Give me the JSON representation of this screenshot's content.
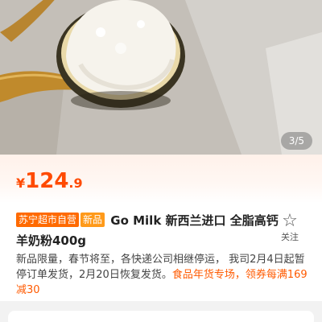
{
  "gallery": {
    "counter": "3/5"
  },
  "price": {
    "currency": "¥",
    "integer": "124",
    "decimal": ".9"
  },
  "product": {
    "tag_store": "苏宁超市自营",
    "tag_new": "新品",
    "title": "Go Milk 新西兰进口 全脂高钙羊奶粉400g"
  },
  "follow": {
    "icon": "star-outline-icon",
    "label": "关注"
  },
  "notice": {
    "text": "新品限量，春节将至，各快递公司相继停运， 我司2月4日起暂停订单发货，2月20日恢复发货。",
    "promo": "食品年货专场，领券每满169减30"
  },
  "colors": {
    "accent": "#ff4a00",
    "tag_store": "#ff6a00",
    "tag_new": "#ff9a1a"
  }
}
